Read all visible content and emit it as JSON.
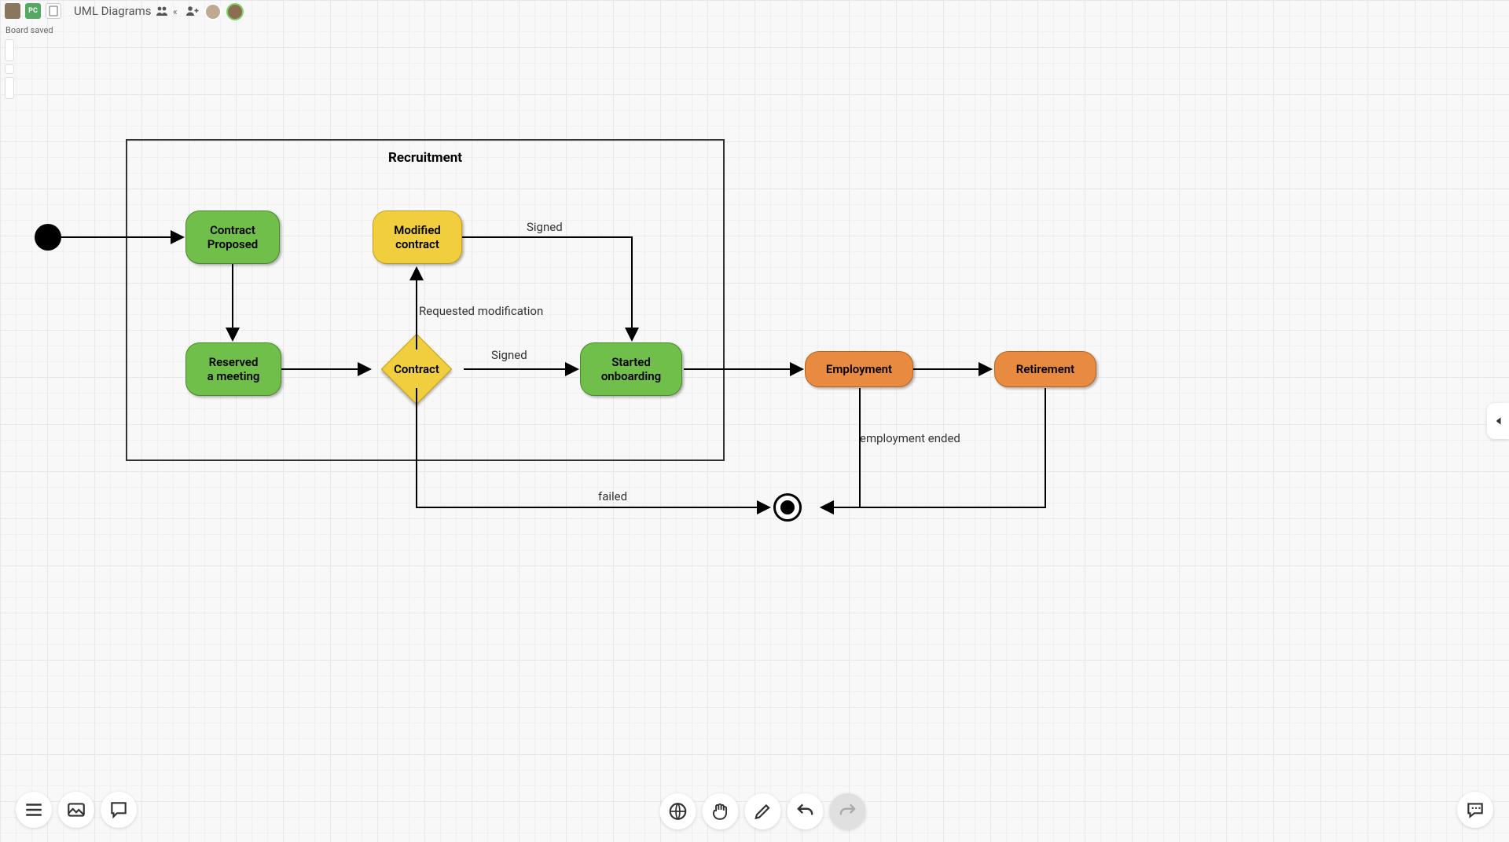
{
  "app": {
    "title": "UML Diagrams",
    "status": "Board saved",
    "pc_badge": "PC"
  },
  "frame": {
    "title": "Recruitment"
  },
  "nodes": {
    "contract_proposed": "Contract\nProposed",
    "reserved_meeting": "Reserved\na meeting",
    "modified_contract": "Modified\ncontract",
    "contract": "Contract",
    "started_onboarding": "Started\nonboarding",
    "employment": "Employment",
    "retirement": "Retirement"
  },
  "edges": {
    "signed1": "Signed",
    "signed2": "Signed",
    "req_mod": "Requested modification",
    "emp_end": "employment ended",
    "failed": "failed"
  },
  "chart_data": {
    "type": "diagram",
    "subtype": "uml-state-machine",
    "title": "Recruitment",
    "states": [
      {
        "id": "start",
        "kind": "initial"
      },
      {
        "id": "contract_proposed",
        "label": "Contract Proposed",
        "color": "green",
        "in_frame": true
      },
      {
        "id": "reserved_meeting",
        "label": "Reserved a meeting",
        "color": "green",
        "in_frame": true
      },
      {
        "id": "modified_contract",
        "label": "Modified contract",
        "color": "yellow",
        "in_frame": true
      },
      {
        "id": "contract",
        "label": "Contract",
        "kind": "decision",
        "color": "yellow",
        "in_frame": true
      },
      {
        "id": "started_onboarding",
        "label": "Started onboarding",
        "color": "green",
        "in_frame": true
      },
      {
        "id": "employment",
        "label": "Employment",
        "color": "orange",
        "in_frame": false
      },
      {
        "id": "retirement",
        "label": "Retirement",
        "color": "orange",
        "in_frame": false
      },
      {
        "id": "final",
        "kind": "final"
      }
    ],
    "container": {
      "id": "recruitment_frame",
      "label": "Recruitment",
      "members": [
        "contract_proposed",
        "reserved_meeting",
        "modified_contract",
        "contract",
        "started_onboarding"
      ]
    },
    "transitions": [
      {
        "from": "start",
        "to": "contract_proposed"
      },
      {
        "from": "contract_proposed",
        "to": "reserved_meeting"
      },
      {
        "from": "reserved_meeting",
        "to": "contract"
      },
      {
        "from": "contract",
        "to": "modified_contract",
        "label": "Requested modification"
      },
      {
        "from": "modified_contract",
        "to": "started_onboarding",
        "label": "Signed"
      },
      {
        "from": "contract",
        "to": "started_onboarding",
        "label": "Signed"
      },
      {
        "from": "contract",
        "to": "final",
        "label": "failed"
      },
      {
        "from": "started_onboarding",
        "to": "employment"
      },
      {
        "from": "employment",
        "to": "retirement"
      },
      {
        "from": "employment",
        "to": "final",
        "label": "employment ended"
      },
      {
        "from": "retirement",
        "to": "final"
      }
    ]
  }
}
